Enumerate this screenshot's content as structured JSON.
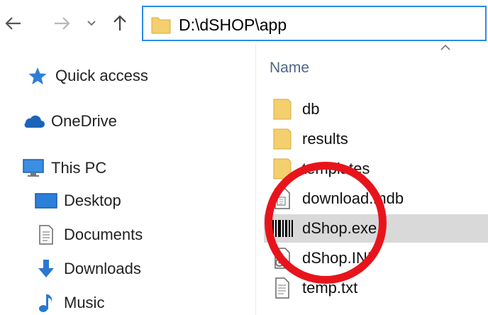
{
  "navigation": {
    "back_icon": "arrow-left-icon",
    "forward_icon": "arrow-right-icon",
    "recent_icon": "chevron-down-icon",
    "up_icon": "arrow-up-icon"
  },
  "address_bar": {
    "path": "D:\\dSHOP\\app",
    "icon": "folder-icon"
  },
  "sidebar": {
    "items": [
      {
        "label": "Quick access",
        "icon": "star-icon"
      },
      {
        "label": "OneDrive",
        "icon": "cloud-icon"
      },
      {
        "label": "This PC",
        "icon": "computer-icon"
      },
      {
        "label": "Desktop",
        "icon": "desktop-icon"
      },
      {
        "label": "Documents",
        "icon": "document-icon"
      },
      {
        "label": "Downloads",
        "icon": "download-icon"
      },
      {
        "label": "Music",
        "icon": "music-icon"
      }
    ]
  },
  "file_list": {
    "column_header": "Name",
    "sort_indicator": "^",
    "files": [
      {
        "name": "db",
        "icon": "folder-icon",
        "selected": false
      },
      {
        "name": "results",
        "icon": "folder-icon",
        "selected": false
      },
      {
        "name": "templates",
        "icon": "folder-icon",
        "selected": false
      },
      {
        "name": "download.mdb",
        "icon": "database-file-icon",
        "selected": false
      },
      {
        "name": "dShop.exe",
        "icon": "barcode-icon",
        "selected": true
      },
      {
        "name": "dShop.INI",
        "icon": "settings-file-icon",
        "selected": false
      },
      {
        "name": "temp.txt",
        "icon": "text-file-icon",
        "selected": false
      }
    ]
  },
  "colors": {
    "accent": "#2b8ce3",
    "highlight_circle": "#e8141c",
    "selection": "#d9d9d9",
    "folder": "#f3cf6e"
  }
}
